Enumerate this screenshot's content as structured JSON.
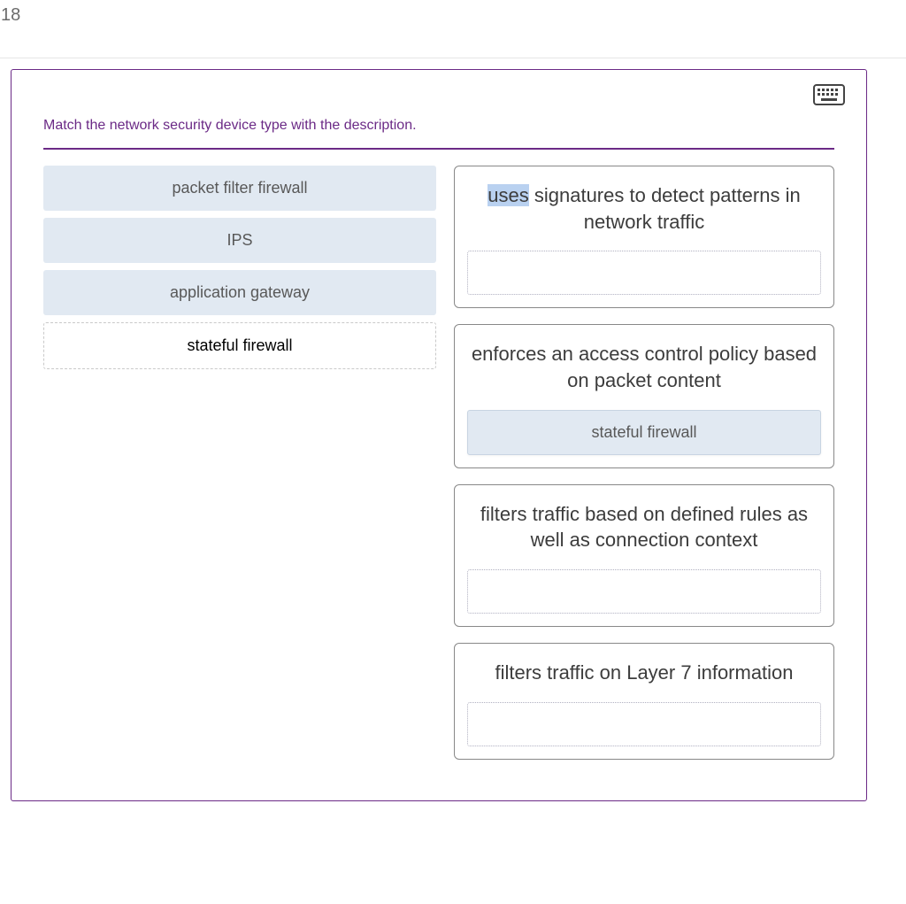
{
  "page_number": "18",
  "question": "Match the network security device type with the description.",
  "sources": [
    {
      "label": "packet filter firewall",
      "ghost": false
    },
    {
      "label": "IPS",
      "ghost": false
    },
    {
      "label": "application gateway",
      "ghost": false
    },
    {
      "label": "stateful firewall",
      "ghost": true
    }
  ],
  "targets": [
    {
      "description_pre_hl": "uses",
      "description_post_hl": " signatures to detect patterns in network traffic",
      "highlight_first_word": true,
      "dropped": null
    },
    {
      "description": "enforces an access control policy based on packet content",
      "dropped": "stateful firewall"
    },
    {
      "description": "filters traffic based on defined rules as well as connection context",
      "dropped": null
    },
    {
      "description": "filters traffic on Layer 7 information",
      "dropped": null
    }
  ],
  "icons": {
    "keyboard": "keyboard-icon"
  }
}
